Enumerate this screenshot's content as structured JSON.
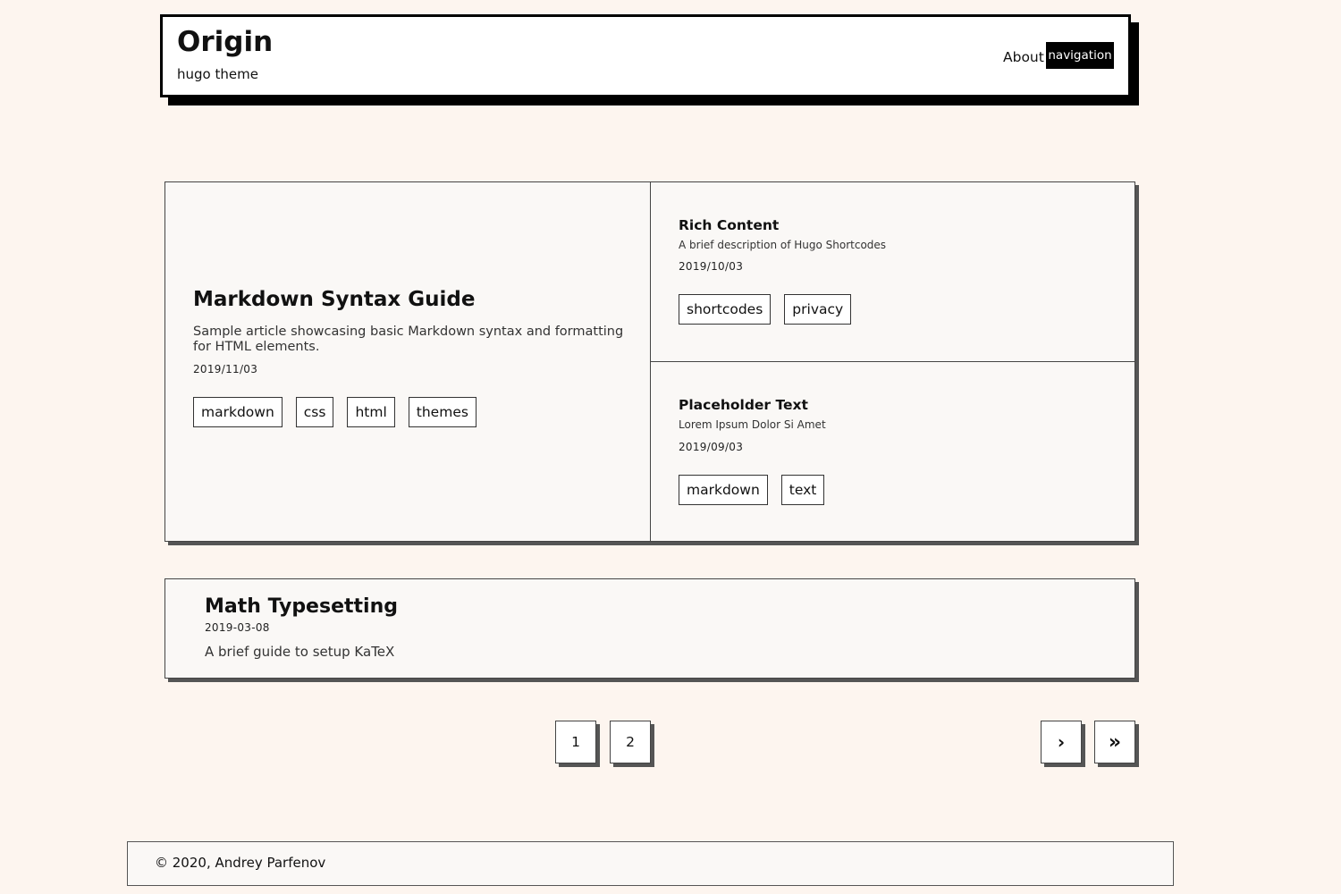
{
  "header": {
    "title": "Origin",
    "subtitle": "hugo theme",
    "nav": {
      "about": "About",
      "navigation": "navigation"
    }
  },
  "featured": [
    {
      "title": "Markdown Syntax Guide",
      "description": "Sample article showcasing basic Markdown syntax and formatting for HTML elements.",
      "date": "2019/11/03",
      "tags": [
        "markdown",
        "css",
        "html",
        "themes"
      ]
    },
    {
      "title": "Rich Content",
      "description": "A brief description of Hugo Shortcodes",
      "date": "2019/10/03",
      "tags": [
        "shortcodes",
        "privacy"
      ]
    },
    {
      "title": "Placeholder Text",
      "description": "Lorem Ipsum Dolor Si Amet",
      "date": "2019/09/03",
      "tags": [
        "markdown",
        "text"
      ]
    }
  ],
  "posts": [
    {
      "title": "Math Typesetting",
      "date": "2019-03-08",
      "description": "A brief guide to setup KaTeX"
    }
  ],
  "pagination": {
    "pages": [
      "1",
      "2"
    ],
    "next": "›",
    "last": "»"
  },
  "footer": {
    "copyright": "© 2020, Andrey Parfenov"
  },
  "colors": {
    "background": "#fdf5ef",
    "card": "#faf8f6",
    "accent": "#000000"
  }
}
